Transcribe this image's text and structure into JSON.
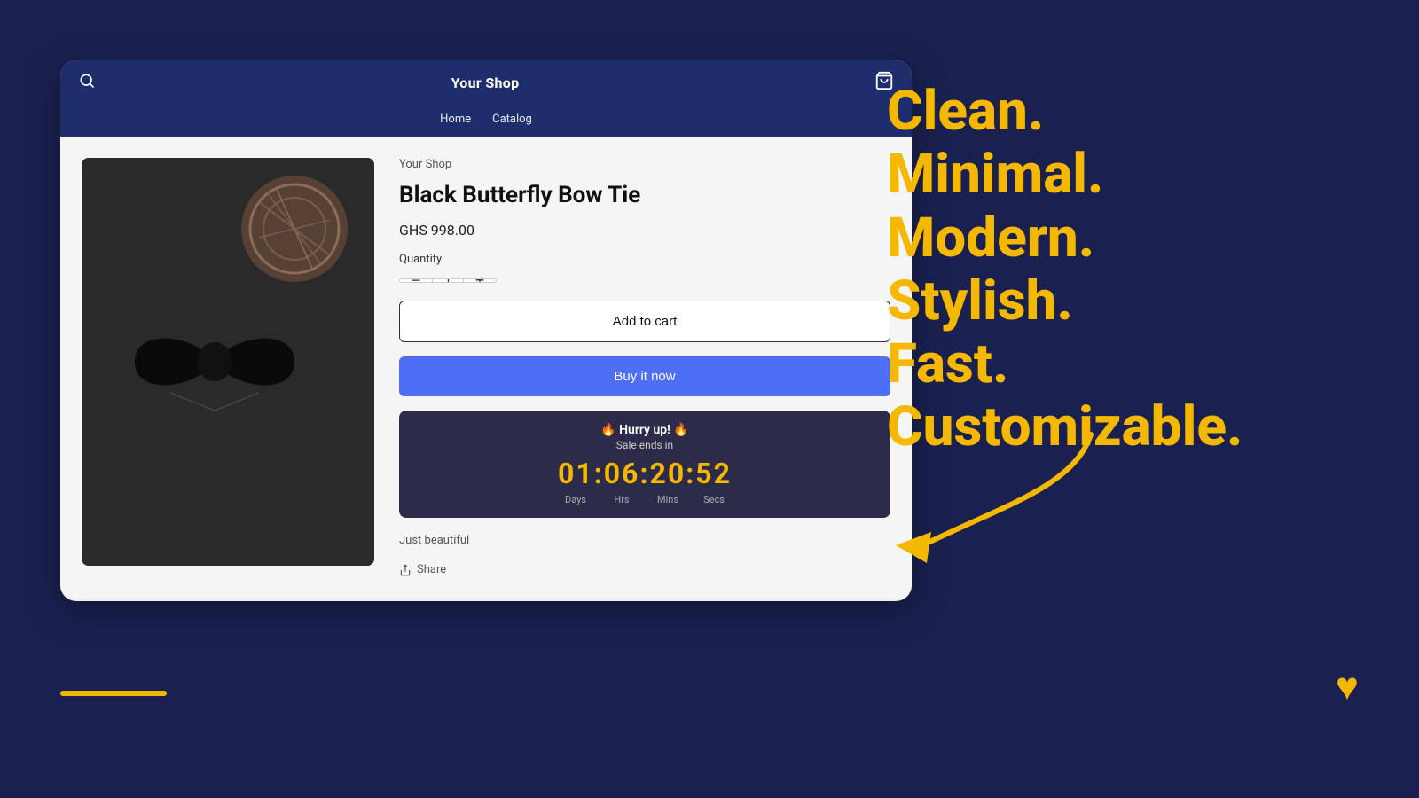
{
  "background": {
    "color": "#1a2150"
  },
  "browser": {
    "shop_title": "Your Shop",
    "nav_items": [
      "Home",
      "Catalog"
    ]
  },
  "product": {
    "shop_label": "Your Shop",
    "title": "Black Butterfly Bow Tie",
    "price": "GHS 998.00",
    "quantity_label": "Quantity",
    "quantity_value": "1",
    "add_to_cart_label": "Add to cart",
    "buy_now_label": "Buy it now",
    "description": "Just beautiful",
    "share_label": "Share"
  },
  "countdown": {
    "hurry_text": "🔥 Hurry up! 🔥",
    "sale_ends_text": "Sale ends in",
    "timer": "01:06:20:52",
    "labels": [
      "Days",
      "Hrs",
      "Mins",
      "Secs"
    ]
  },
  "tagline": {
    "lines": [
      "Clean.",
      "Minimal.",
      "Modern.",
      "Stylish.",
      "Fast.",
      "Customizable."
    ]
  },
  "icons": {
    "search": "🔍",
    "cart": "🛒",
    "share": "↑",
    "heart": "♥",
    "minus": "−",
    "plus": "+"
  }
}
